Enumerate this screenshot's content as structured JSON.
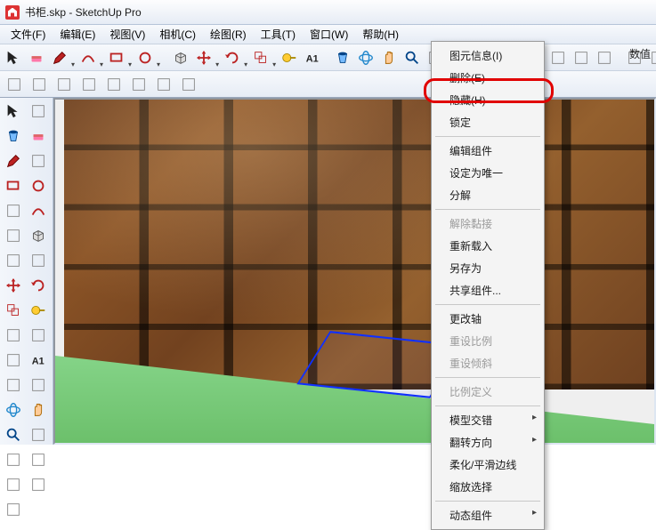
{
  "window": {
    "title": "书柜.skp - SketchUp Pro"
  },
  "menubar": {
    "items": [
      {
        "label": "文件(F)"
      },
      {
        "label": "编辑(E)"
      },
      {
        "label": "视图(V)"
      },
      {
        "label": "相机(C)"
      },
      {
        "label": "绘图(R)"
      },
      {
        "label": "工具(T)"
      },
      {
        "label": "窗口(W)"
      },
      {
        "label": "帮助(H)"
      }
    ]
  },
  "right_label": "数值",
  "context_menu": {
    "items": [
      {
        "label": "图元信息(I)",
        "type": "item"
      },
      {
        "label": "删除(E)",
        "type": "item"
      },
      {
        "label": "隐藏(H)",
        "type": "item",
        "highlighted": true
      },
      {
        "label": "锁定",
        "type": "item"
      },
      {
        "type": "sep"
      },
      {
        "label": "编辑组件",
        "type": "item"
      },
      {
        "label": "设定为唯一",
        "type": "item"
      },
      {
        "label": "分解",
        "type": "item"
      },
      {
        "type": "sep"
      },
      {
        "label": "解除黏接",
        "type": "item",
        "disabled": true
      },
      {
        "label": "重新载入",
        "type": "item"
      },
      {
        "label": "另存为",
        "type": "item"
      },
      {
        "label": "共享组件...",
        "type": "item"
      },
      {
        "type": "sep"
      },
      {
        "label": "更改轴",
        "type": "item"
      },
      {
        "label": "重设比例",
        "type": "item",
        "disabled": true
      },
      {
        "label": "重设倾斜",
        "type": "item",
        "disabled": true
      },
      {
        "type": "sep"
      },
      {
        "label": "比例定义",
        "type": "item",
        "disabled": true
      },
      {
        "type": "sep"
      },
      {
        "label": "模型交错",
        "type": "item",
        "submenu": true
      },
      {
        "label": "翻转方向",
        "type": "item",
        "submenu": true
      },
      {
        "label": "柔化/平滑边线",
        "type": "item"
      },
      {
        "label": "缩放选择",
        "type": "item"
      },
      {
        "type": "sep"
      },
      {
        "label": "动态组件",
        "type": "item",
        "submenu": true
      }
    ]
  },
  "toolbar_top1": [
    "select",
    "eraser",
    "line",
    "arc",
    "rect",
    "circle",
    "pushpull",
    "move",
    "rotate",
    "scale",
    "tape",
    "text",
    "paint",
    "orbit",
    "pan",
    "zoom",
    "zoom-ext",
    "dim",
    "label",
    "section",
    "axes",
    "walk",
    "look",
    "protractor",
    "3dtext",
    "followme",
    "offset",
    "outer-shell",
    "tool-a",
    "tool-b",
    "tool-c",
    "tool-d"
  ],
  "toolbar_top2": [
    "make-comp",
    "paint-bucket",
    "bucket2",
    "eraser2",
    "poly",
    "poly2",
    "text2",
    "dim2"
  ],
  "left_tools": [
    "select",
    "make-comp",
    "paint",
    "eraser",
    "line",
    "freehand",
    "rect",
    "circle",
    "poly",
    "arc",
    "pie",
    "pushpull",
    "followme",
    "offset",
    "move",
    "rotate",
    "scale",
    "tape",
    "protractor",
    "axes",
    "dim",
    "text",
    "3dtext",
    "section",
    "orbit",
    "pan",
    "zoom",
    "zoom-win",
    "zoom-ext",
    "prev",
    "position",
    "look",
    "walk"
  ],
  "icons": {
    "select": "arrow",
    "eraser": "eraser",
    "line": "pencil",
    "arc": "arc",
    "rect": "rect",
    "circle": "circle",
    "pushpull": "box3d",
    "move": "cross",
    "rotate": "rot",
    "scale": "scale",
    "tape": "tape",
    "text": "A1",
    "paint": "bucket",
    "orbit": "orbit",
    "pan": "hand",
    "zoom": "mag"
  }
}
